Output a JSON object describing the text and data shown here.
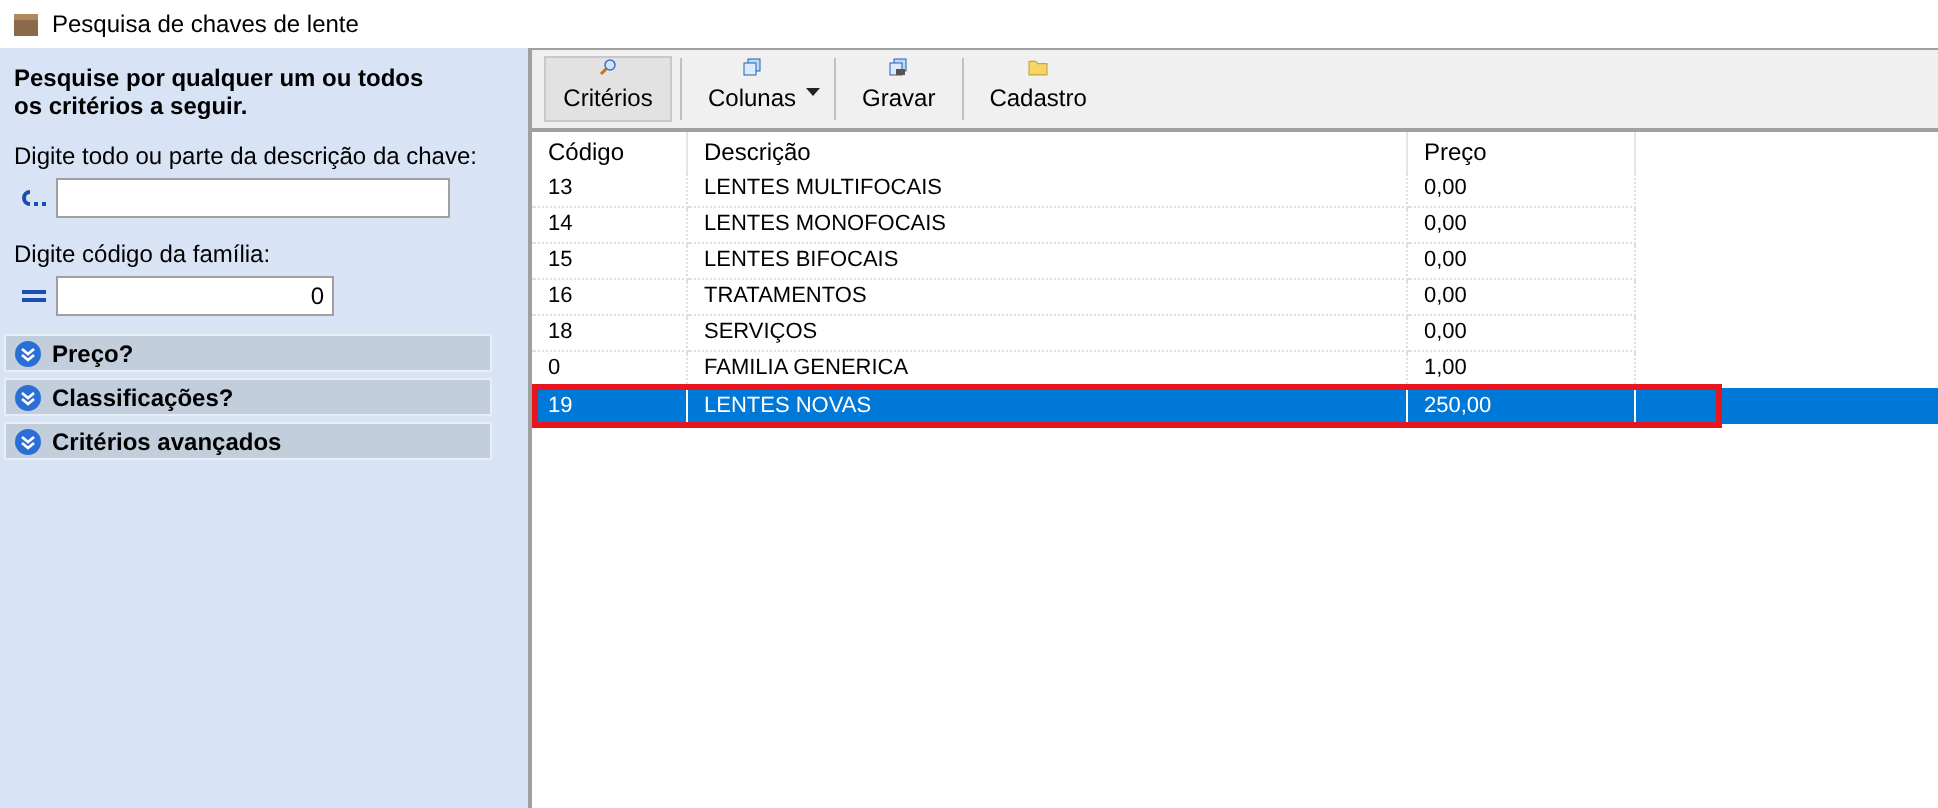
{
  "window": {
    "title": "Pesquisa de chaves de lente"
  },
  "search_panel": {
    "heading": "Pesquise por qualquer um ou todos os critérios a seguir.",
    "description_label": "Digite todo ou parte da descrição da chave:",
    "family_label": "Digite código da família:",
    "family_value": "0",
    "sections": [
      {
        "label": "Preço?"
      },
      {
        "label": "Classificações?"
      },
      {
        "label": "Critérios avançados"
      }
    ]
  },
  "toolbar": [
    {
      "kind": "search",
      "label": "Critérios",
      "selected": true
    },
    {
      "kind": "columns",
      "label": "Colunas",
      "selected": false
    },
    {
      "kind": "save",
      "label": "Gravar",
      "selected": false
    },
    {
      "kind": "folder",
      "label": "Cadastro",
      "selected": false
    }
  ],
  "table": {
    "columns": [
      "Código",
      "Descrição",
      "Preço"
    ],
    "rows": [
      {
        "cells": [
          "13",
          "LENTES MULTIFOCAIS",
          "0,00"
        ],
        "selected": false,
        "highlighted": false
      },
      {
        "cells": [
          "14",
          "LENTES MONOFOCAIS",
          "0,00"
        ],
        "selected": false,
        "highlighted": false
      },
      {
        "cells": [
          "15",
          "LENTES BIFOCAIS",
          "0,00"
        ],
        "selected": false,
        "highlighted": false
      },
      {
        "cells": [
          "16",
          "TRATAMENTOS",
          "0,00"
        ],
        "selected": false,
        "highlighted": false
      },
      {
        "cells": [
          "18",
          "SERVIÇOS",
          "0,00"
        ],
        "selected": false,
        "highlighted": false
      },
      {
        "cells": [
          "0",
          "FAMILIA GENERICA",
          "1,00"
        ],
        "selected": false,
        "highlighted": false
      },
      {
        "cells": [
          "19",
          "LENTES NOVAS",
          "250,00"
        ],
        "selected": true,
        "highlighted": true
      }
    ]
  }
}
